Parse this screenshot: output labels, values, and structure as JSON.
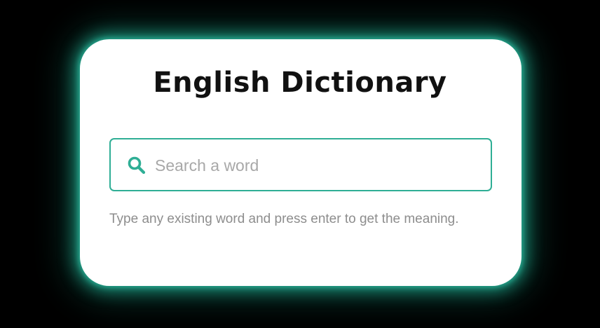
{
  "app": {
    "title": "English Dictionary"
  },
  "search": {
    "placeholder": "Search a word",
    "value": "",
    "icon": "search-icon"
  },
  "hint": {
    "text": "Type any existing word and press enter to get the meaning."
  },
  "colors": {
    "background": "#000000",
    "card": "#ffffff",
    "accent": "#2fae95",
    "glow": "#1fa087",
    "title": "#111111",
    "placeholder": "#a8a8a8",
    "hint": "#8d8d8d"
  }
}
